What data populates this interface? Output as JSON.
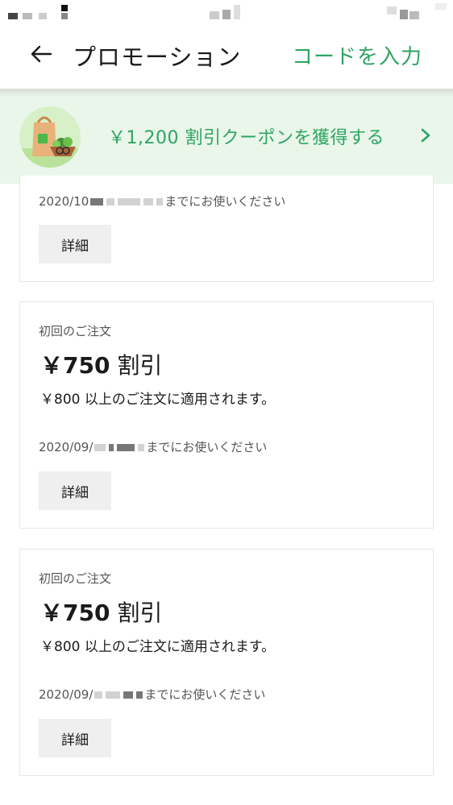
{
  "header": {
    "title": "プロモーション",
    "code_link": "コードを入力"
  },
  "promo_banner": {
    "text": "￥1,200 割引クーポンを獲得する"
  },
  "coupons": [
    {
      "expiry_prefix": "2020/10",
      "expiry_suffix": "までにお使いください",
      "details_label": "詳細"
    },
    {
      "label": "初回のご注文",
      "amount": "￥750",
      "amount_suffix": "割引",
      "condition": "￥800 以上のご注文に適用されます。",
      "expiry_prefix": "2020/09/",
      "expiry_suffix": "までにお使いください",
      "details_label": "詳細"
    },
    {
      "label": "初回のご注文",
      "amount": "￥750",
      "amount_suffix": "割引",
      "condition": "￥800 以上のご注文に適用されます。",
      "expiry_prefix": "2020/09/",
      "expiry_suffix": "までにお使いください",
      "details_label": "詳細"
    }
  ],
  "colors": {
    "accent": "#2da562",
    "banner_bg": "#eaf6ea"
  },
  "icons": {
    "back": "arrow-left-icon",
    "chevron": "chevron-right-icon",
    "promo_image": "grocery-bag-illustration"
  }
}
